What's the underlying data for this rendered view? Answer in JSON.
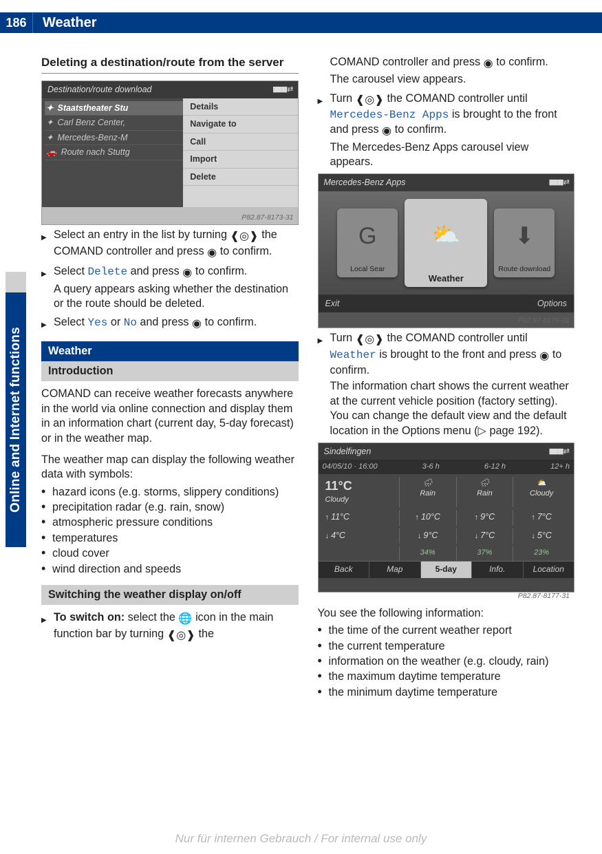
{
  "header": {
    "page_number": "186",
    "title": "Weather"
  },
  "side_tab": "Online and Internet functions",
  "left": {
    "h_delete": "Deleting a destination/route from the server",
    "shot1": {
      "title": "Destination/route download",
      "rows": [
        "Staatstheater Stu",
        "Carl Benz Center,",
        "Mercedes-Benz-M",
        "Route nach Stuttg"
      ],
      "menu": [
        "Details",
        "Navigate to",
        "Call",
        "Import",
        "Delete"
      ],
      "caption": "P82.87-8173-31"
    },
    "step1_a": "Select an entry in the list by turning ",
    "step1_b": " the COMAND controller and press ",
    "step1_c": " to confirm.",
    "step2_a": "Select ",
    "step2_delete": "Delete",
    "step2_b": " and press ",
    "step2_c": " to confirm.",
    "step2_result": "A query appears asking whether the destination or the route should be deleted.",
    "step3_a": "Select ",
    "step3_yes": "Yes",
    "step3_or": " or ",
    "step3_no": "No",
    "step3_b": " and press ",
    "step3_c": " to confirm.",
    "banner_weather": "Weather",
    "banner_intro": "Introduction",
    "intro_p1": "COMAND can receive weather forecasts anywhere in the world via online connection and display them in an information chart (current day, 5-day forecast) or in the weather map.",
    "intro_p2": "The weather map can display the following weather data with symbols:",
    "intro_list": [
      "hazard icons (e.g. storms, slippery conditions)",
      "precipitation radar (e.g. rain, snow)",
      "atmospheric pressure conditions",
      "temperatures",
      "cloud cover",
      "wind direction and speeds"
    ],
    "banner_switch": "Switching the weather display on/off",
    "switch_a": "To switch on:",
    "switch_b": " select the ",
    "switch_c": " icon in the main function bar by turning ",
    "switch_d": " the"
  },
  "right": {
    "cont_a": "COMAND controller and press ",
    "cont_b": " to confirm.",
    "cont_result": "The carousel view appears.",
    "stepA_a": "Turn ",
    "stepA_b": " the COMAND controller until ",
    "stepA_app": "Mercedes-Benz Apps",
    "stepA_c": " is brought to the front and press ",
    "stepA_d": " to confirm.",
    "stepA_result": "The Mercedes-Benz Apps carousel view appears.",
    "shot2": {
      "title": "Mercedes-Benz Apps",
      "tiles": {
        "left": "Local Sear",
        "center": "Weather",
        "right": "Route download"
      },
      "exit": "Exit",
      "options": "Options",
      "caption": "P82.87-8176-31"
    },
    "stepB_a": "Turn ",
    "stepB_b": " the COMAND controller until ",
    "stepB_app": "Weather",
    "stepB_c": " is brought to the front and press ",
    "stepB_d": " to confirm.",
    "stepB_result": "The information chart shows the current weather at the current vehicle position (factory setting). You can change the default view and the default location in the Options menu (▷ page 192).",
    "shot3": {
      "title": "Sindelfingen",
      "subheads": [
        "04/05/10 · 16:00",
        "3-6 h",
        "6-12 h",
        "12+ h"
      ],
      "now": {
        "temp": "11°C",
        "cond": "Cloudy"
      },
      "cols_cond": [
        "Rain",
        "Rain",
        "Cloudy"
      ],
      "row_hi": [
        "11°C",
        "10°C",
        "9°C",
        "7°C"
      ],
      "row_lo": [
        "4°C",
        "9°C",
        "7°C",
        "5°C"
      ],
      "row_pct": [
        "",
        "34%",
        "37%",
        "23%"
      ],
      "tabs": [
        "Back",
        "Map",
        "5-day",
        "Info.",
        "Location"
      ],
      "caption": "P82.87-8177-31"
    },
    "info_intro": "You see the following information:",
    "info_list": [
      "the time of the current weather report",
      "the current temperature",
      "information on the weather (e.g. cloudy, rain)",
      "the maximum daytime temperature",
      "the minimum daytime temperature"
    ]
  },
  "footer": "Nur für internen Gebrauch / For internal use only",
  "chart_data": {
    "type": "table",
    "title": "Sindelfingen weather information chart",
    "timestamp": "04/05/10 · 16:00",
    "current": {
      "temperature_c": 11,
      "condition": "Cloudy"
    },
    "periods": [
      "3-6 h",
      "6-12 h",
      "12+ h"
    ],
    "conditions": [
      "Rain",
      "Rain",
      "Cloudy"
    ],
    "high_c": [
      11,
      10,
      9,
      7
    ],
    "low_c": [
      4,
      9,
      7,
      5
    ],
    "precip_pct": [
      null,
      34,
      37,
      23
    ],
    "bottom_tabs": [
      "Back",
      "Map",
      "5-day",
      "Info.",
      "Location"
    ],
    "active_tab": "5-day"
  }
}
